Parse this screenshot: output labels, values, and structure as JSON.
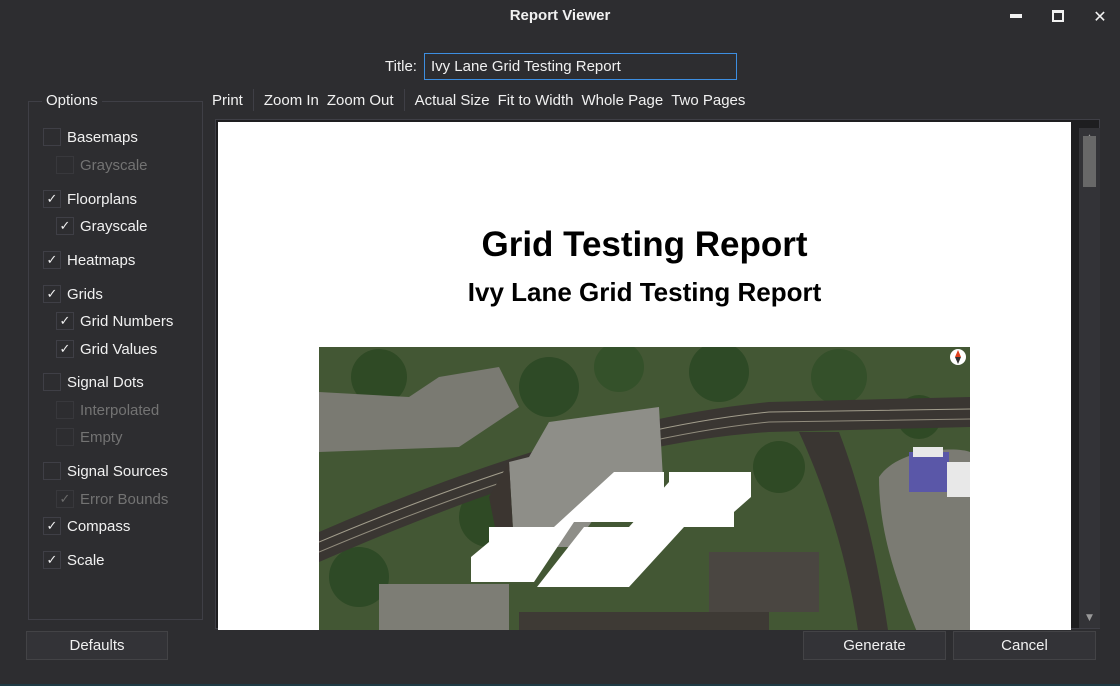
{
  "window": {
    "title": "Report Viewer",
    "controls": {
      "minimize": "minimize-icon",
      "maximize": "maximize-icon",
      "close": "close-icon",
      "close_glyph": "✕"
    }
  },
  "title_field": {
    "label": "Title:",
    "value": "Ivy Lane Grid Testing Report"
  },
  "options": {
    "legend": "Options",
    "items": [
      {
        "label": "Basemaps",
        "checked": false,
        "enabled": true,
        "indent": 0
      },
      {
        "label": "Grayscale",
        "checked": false,
        "enabled": false,
        "indent": 1
      },
      {
        "label": "Floorplans",
        "checked": true,
        "enabled": true,
        "indent": 0
      },
      {
        "label": "Grayscale",
        "checked": true,
        "enabled": true,
        "indent": 1
      },
      {
        "label": "Heatmaps",
        "checked": true,
        "enabled": true,
        "indent": 0
      },
      {
        "label": "Grids",
        "checked": true,
        "enabled": true,
        "indent": 0
      },
      {
        "label": "Grid Numbers",
        "checked": true,
        "enabled": true,
        "indent": 1
      },
      {
        "label": "Grid Values",
        "checked": true,
        "enabled": true,
        "indent": 1
      },
      {
        "label": "Signal Dots",
        "checked": false,
        "enabled": true,
        "indent": 0
      },
      {
        "label": "Interpolated",
        "checked": false,
        "enabled": false,
        "indent": 1
      },
      {
        "label": "Empty",
        "checked": false,
        "enabled": false,
        "indent": 1
      },
      {
        "label": "Signal Sources",
        "checked": false,
        "enabled": true,
        "indent": 0
      },
      {
        "label": "Error Bounds",
        "checked": true,
        "enabled": false,
        "indent": 1
      },
      {
        "label": "Compass",
        "checked": true,
        "enabled": true,
        "indent": 0
      },
      {
        "label": "Scale",
        "checked": true,
        "enabled": true,
        "indent": 0
      }
    ],
    "check_glyph": "✓"
  },
  "toolbar": {
    "print": "Print",
    "zoom_in": "Zoom In",
    "zoom_out": "Zoom Out",
    "actual_size": "Actual Size",
    "fit_to_width": "Fit to Width",
    "whole_page": "Whole Page",
    "two_pages": "Two Pages"
  },
  "report": {
    "title": "Grid Testing Report",
    "subtitle": "Ivy Lane Grid Testing Report",
    "map": {
      "type": "satellite-basemap",
      "compass_icon": "compass-icon"
    }
  },
  "scrollbar": {
    "up_glyph": "▲",
    "down_glyph": "▼"
  },
  "buttons": {
    "defaults": "Defaults",
    "generate": "Generate",
    "cancel": "Cancel"
  },
  "colors": {
    "background": "#2d2d30",
    "accent_border": "#3d8ee0",
    "text": "#f1f1f1",
    "disabled_text": "#737373"
  }
}
